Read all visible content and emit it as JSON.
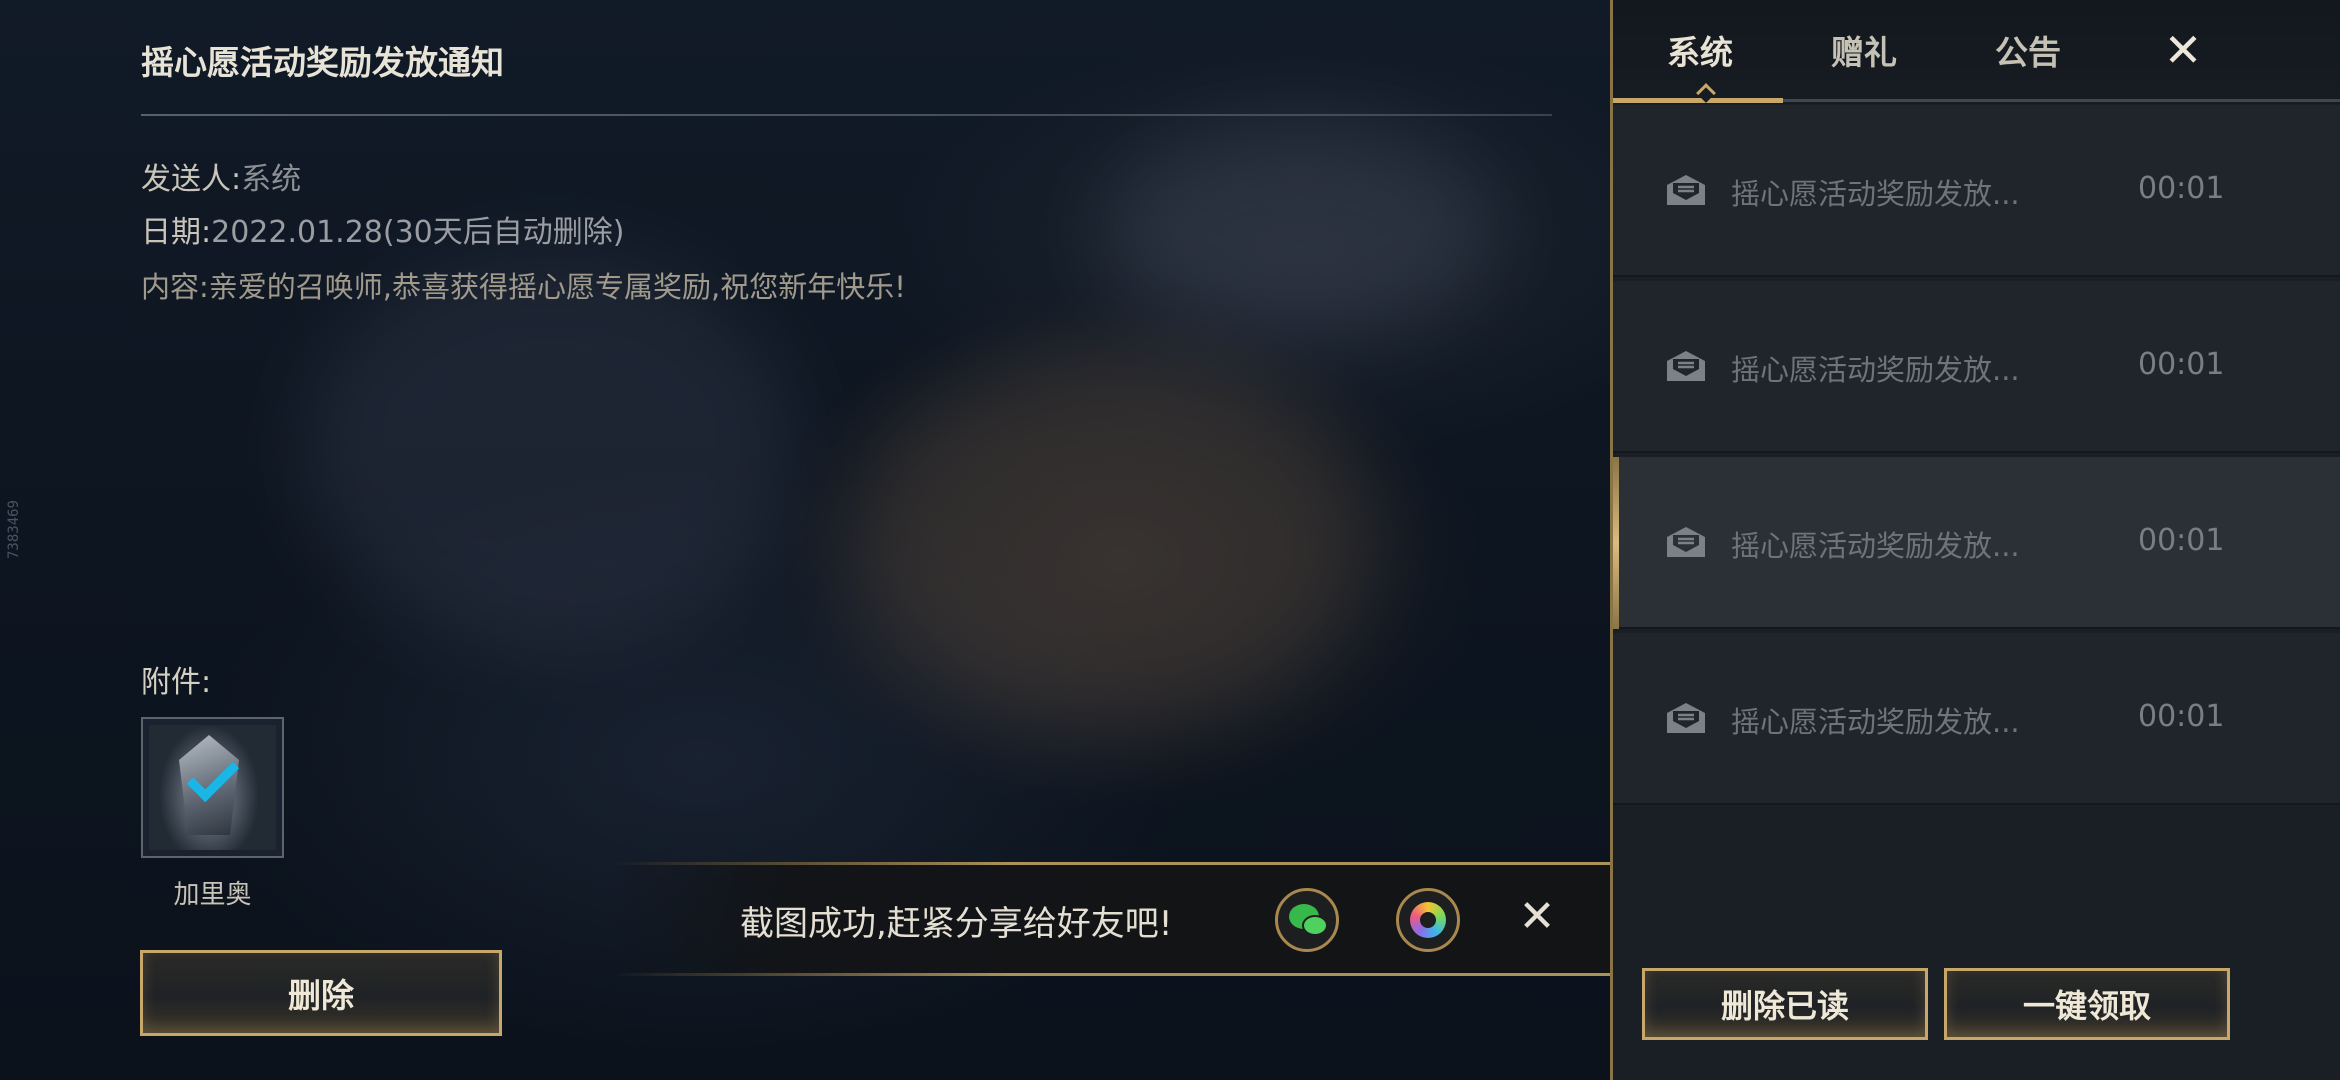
{
  "detail": {
    "title": "摇心愿活动奖励发放通知",
    "sender_label": "发送人:",
    "sender_value": "系统",
    "date_label": "日期:",
    "date_value": "2022.01.28(30天后自动删除)",
    "content": "内容:亲爱的召唤师,恭喜获得摇心愿专属奖励,祝您新年快乐!",
    "attachment_label": "附件:",
    "attachment_name": "加里奥",
    "delete_label": "删除"
  },
  "side_id": "7383469",
  "toast": {
    "message": "截图成功,赶紧分享给好友吧!",
    "close_icon": "✕",
    "share_icons": [
      "wechat-icon",
      "moments-icon"
    ]
  },
  "mail_panel": {
    "tabs": [
      {
        "label": "系统",
        "active": true
      },
      {
        "label": "赠礼",
        "active": false
      },
      {
        "label": "公告",
        "active": false
      }
    ],
    "close_icon": "✕",
    "rows": [
      {
        "subject": "摇心愿活动奖励发放...",
        "time": "00:01",
        "selected": false
      },
      {
        "subject": "摇心愿活动奖励发放...",
        "time": "00:01",
        "selected": false
      },
      {
        "subject": "摇心愿活动奖励发放...",
        "time": "00:01",
        "selected": true
      },
      {
        "subject": "摇心愿活动奖励发放...",
        "time": "00:01",
        "selected": false
      }
    ],
    "delete_read_label": "删除已读",
    "collect_all_label": "一键领取"
  },
  "colors": {
    "accent_gold": "#c8a86a",
    "panel_bg": "#1a1f25",
    "check_blue": "#19b6e6"
  }
}
